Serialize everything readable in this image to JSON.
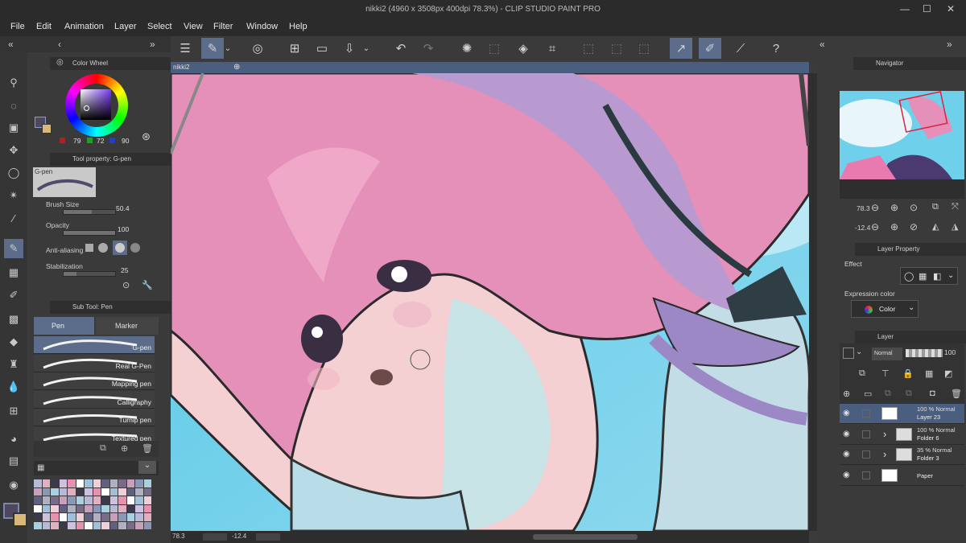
{
  "app": {
    "title": "nikki2 (4960 x 3508px 400dpi 78.3%)  - CLIP STUDIO PAINT PRO",
    "minimize": "—",
    "maximize": "☐",
    "close": "✕"
  },
  "menu": [
    "File",
    "Edit",
    "Animation",
    "Layer",
    "Select",
    "View",
    "Filter",
    "Window",
    "Help"
  ],
  "color_wheel": {
    "title": "Color Wheel",
    "r": "79",
    "g": "72",
    "b": "90",
    "main_color": "#4d4860",
    "sub_color": "#d9b97a"
  },
  "tool_property": {
    "title": "Tool property: G-pen",
    "preset_name": "G-pen",
    "brush_size_label": "Brush Size",
    "brush_size_value": "50.4",
    "opacity_label": "Opacity",
    "opacity_value": "100",
    "antialias_label": "Anti-aliasing",
    "stabilization_label": "Stabilization",
    "stabilization_value": "25",
    "brush_size_fill": 0.55,
    "opacity_fill": 1.0,
    "stabilization_fill": 0.25
  },
  "sub_tool": {
    "title": "Sub Tool: Pen",
    "tabs": [
      "Pen",
      "Marker"
    ],
    "items": [
      "G-pen",
      "Real G-Pen",
      "Mapping pen",
      "Calligraphy",
      "Turnip pen",
      "Textured pen"
    ]
  },
  "canvas": {
    "tab_label": "nikki2",
    "zoom": "78.3",
    "rotation": "-12.4"
  },
  "navigator": {
    "title": "Navigator",
    "zoom": "78.3",
    "rotation": "-12.4"
  },
  "layer_property": {
    "title": "Layer Property",
    "effect_label": "Effect",
    "expression_label": "Expression color",
    "expression_value": "Color"
  },
  "layers_panel": {
    "title": "Layer",
    "blend_mode": "Normal",
    "opacity": "100",
    "layers": [
      {
        "line1": "100 % Normal",
        "line2": "Layer 23",
        "selected": true
      },
      {
        "line1": "100 % Normal",
        "line2": "Folder 6",
        "selected": false
      },
      {
        "line1": "35 % Normal",
        "line2": "Folder 3",
        "selected": false
      },
      {
        "line1": "",
        "line2": "Paper",
        "selected": false
      }
    ]
  },
  "colors": {
    "accent": "#5b6d8a",
    "sky": "#5ecbe6",
    "hair": "#e590b8"
  }
}
